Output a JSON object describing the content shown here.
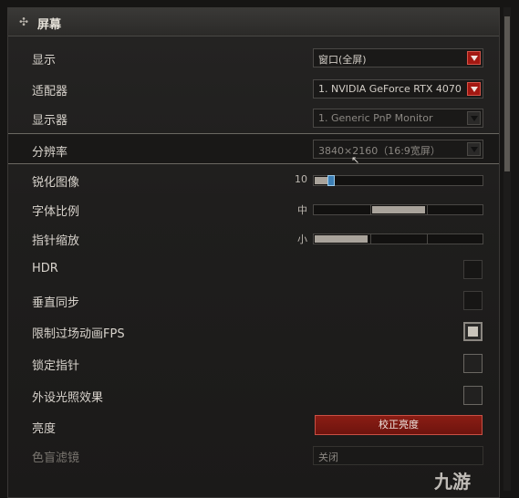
{
  "header": {
    "title": "屏幕",
    "icon": "crosshair-icon"
  },
  "rows": {
    "display_mode": {
      "label": "显示",
      "value": "窗口(全屏)"
    },
    "adapter": {
      "label": "适配器",
      "value": "1. NVIDIA GeForce RTX 4070 T"
    },
    "monitor": {
      "label": "显示器",
      "value": "1. Generic PnP Monitor"
    },
    "resolution": {
      "label": "分辨率",
      "value": "3840×2160（16:9宽屏）"
    },
    "sharpen": {
      "label": "锐化图像",
      "value_text": "10",
      "value": 0.1
    },
    "font_scale": {
      "label": "字体比例",
      "value_text": "中",
      "value": 0.5
    },
    "cursor_scale": {
      "label": "指针缩放",
      "value_text": "小",
      "value": 0.25
    },
    "hdr": {
      "label": "HDR",
      "checked": false
    },
    "vsync": {
      "label": "垂直同步",
      "checked": false
    },
    "limit_fps": {
      "label": "限制过场动画FPS",
      "checked": true
    },
    "lock_cursor": {
      "label": "锁定指针",
      "checked": false
    },
    "peripheral_light": {
      "label": "外设光照效果",
      "checked": false
    },
    "brightness": {
      "label": "亮度",
      "button": "校正亮度"
    },
    "colorblind": {
      "label": "色盲滤镜",
      "value": "关闭"
    }
  },
  "watermark": "九游",
  "colors": {
    "accent_red": "#a31812",
    "slider_handle": "#3d7fb5",
    "background": "#1f1e1d"
  }
}
